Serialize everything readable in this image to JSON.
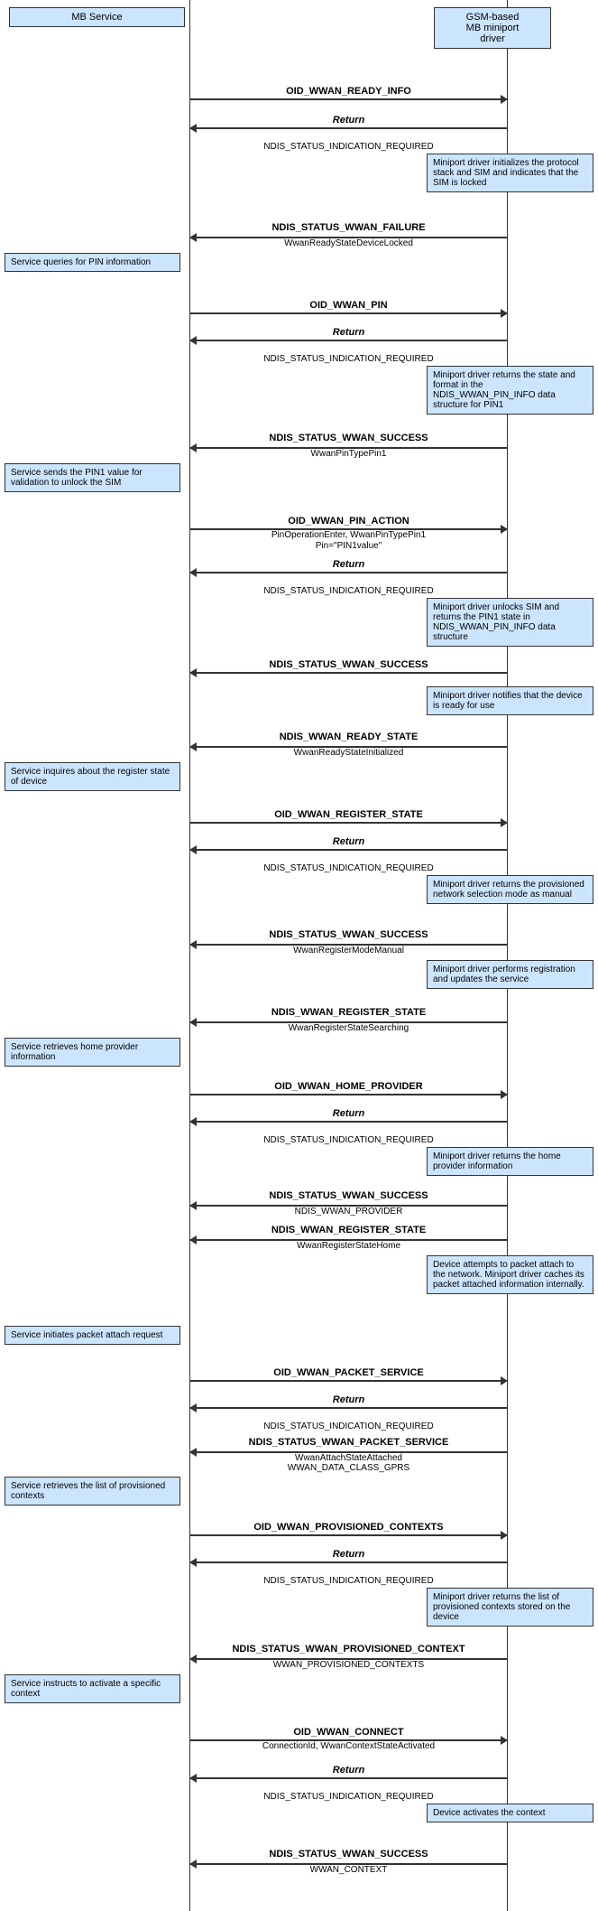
{
  "actors": {
    "left": "MB Service",
    "right": "GSM-based\nMB miniport\ndriver"
  },
  "sequence": [
    {
      "type": "arrow-right",
      "label": "OID_WWAN_READY_INFO",
      "sublabel": ""
    },
    {
      "type": "arrow-left",
      "label": "Return",
      "sublabel": ""
    },
    {
      "type": "text-center",
      "label": "NDIS_STATUS_INDICATION_REQUIRED"
    },
    {
      "type": "note-right",
      "text": "Miniport driver initializes the protocol stack and SIM and indicates that the SIM is locked"
    },
    {
      "type": "arrow-left",
      "label": "NDIS_STATUS_WWAN_FAILURE",
      "sublabel": "WwanReadyStateDeviceLocked"
    },
    {
      "type": "note-left",
      "text": "Service queries for PIN information"
    },
    {
      "type": "arrow-right",
      "label": "OID_WWAN_PIN",
      "sublabel": ""
    },
    {
      "type": "arrow-left",
      "label": "Return",
      "sublabel": ""
    },
    {
      "type": "text-center",
      "label": "NDIS_STATUS_INDICATION_REQUIRED"
    },
    {
      "type": "note-right",
      "text": "Miniport driver returns the state and format in the NDIS_WWAN_PIN_INFO data structure for PIN1"
    },
    {
      "type": "arrow-left",
      "label": "NDIS_STATUS_WWAN_SUCCESS",
      "sublabel": "WwanPinTypePin1"
    },
    {
      "type": "note-left",
      "text": "Service sends the PIN1 value for validation to unlock the SIM"
    },
    {
      "type": "arrow-right",
      "label": "OID_WWAN_PIN_ACTION",
      "sublabel": "PinOperationEnter, WwanPinTypePin1\nPin=\"PIN1value\""
    },
    {
      "type": "arrow-left",
      "label": "Return",
      "sublabel": ""
    },
    {
      "type": "text-center",
      "label": "NDIS_STATUS_INDICATION_REQUIRED"
    },
    {
      "type": "note-right",
      "text": "Miniport driver unlocks SIM and returns the PIN1 state in NDIS_WWAN_PIN_INFO data structure"
    },
    {
      "type": "arrow-left",
      "label": "NDIS_STATUS_WWAN_SUCCESS",
      "sublabel": ""
    },
    {
      "type": "note-right-inline",
      "text": "Miniport driver notifies that the device is ready for use"
    },
    {
      "type": "arrow-left",
      "label": "NDIS_WWAN_READY_STATE",
      "sublabel": "WwanReadyStateInitialized"
    },
    {
      "type": "note-left",
      "text": "Service inquires about the register state of device"
    },
    {
      "type": "arrow-right",
      "label": "OID_WWAN_REGISTER_STATE",
      "sublabel": ""
    },
    {
      "type": "arrow-left",
      "label": "Return",
      "sublabel": ""
    },
    {
      "type": "text-center",
      "label": "NDIS_STATUS_INDICATION_REQUIRED"
    },
    {
      "type": "note-right",
      "text": "Miniport driver returns the provisioned network selection mode as manual"
    },
    {
      "type": "arrow-left",
      "label": "NDIS_STATUS_WWAN_SUCCESS",
      "sublabel": "WwanRegisterModeManual"
    },
    {
      "type": "note-right-inline",
      "text": "Miniport driver performs registration and updates the service"
    },
    {
      "type": "arrow-left",
      "label": "NDIS_WWAN_REGISTER_STATE",
      "sublabel": "WwanRegisterStateSearching"
    },
    {
      "type": "note-left",
      "text": "Service retrieves home provider information"
    },
    {
      "type": "arrow-right",
      "label": "OID_WWAN_HOME_PROVIDER",
      "sublabel": ""
    },
    {
      "type": "arrow-left",
      "label": "Return",
      "sublabel": ""
    },
    {
      "type": "text-center",
      "label": "NDIS_STATUS_INDICATION_REQUIRED"
    },
    {
      "type": "note-right",
      "text": "Miniport driver returns the home provider information"
    },
    {
      "type": "arrow-left",
      "label": "NDIS_STATUS_WWAN_SUCCESS",
      "sublabel": "NDIS_WWAN_PROVIDER"
    },
    {
      "type": "arrow-left",
      "label": "NDIS_WWAN_REGISTER_STATE",
      "sublabel": "WwanRegisterStateHome"
    },
    {
      "type": "note-right",
      "text": "Device attempts to packet attach to the network. Miniport driver caches its packet attached information internally."
    },
    {
      "type": "note-left",
      "text": "Service initiates packet attach request"
    },
    {
      "type": "arrow-right",
      "label": "OID_WWAN_PACKET_SERVICE",
      "sublabel": ""
    },
    {
      "type": "arrow-left",
      "label": "Return",
      "sublabel": ""
    },
    {
      "type": "text-center",
      "label": "NDIS_STATUS_INDICATION_REQUIRED"
    },
    {
      "type": "arrow-left",
      "label": "NDIS_STATUS_WWAN_PACKET_SERVICE",
      "sublabel": "WwanAttachStateAttached\nWWAN_DATA_CLASS_GPRS"
    },
    {
      "type": "note-left",
      "text": "Service retrieves the list of provisioned contexts"
    },
    {
      "type": "arrow-right",
      "label": "OID_WWAN_PROVISIONED_CONTEXTS",
      "sublabel": ""
    },
    {
      "type": "arrow-left",
      "label": "Return",
      "sublabel": ""
    },
    {
      "type": "text-center",
      "label": "NDIS_STATUS_INDICATION_REQUIRED"
    },
    {
      "type": "note-right",
      "text": "Miniport driver returns the list of provisioned contexts stored on the device"
    },
    {
      "type": "arrow-left",
      "label": "NDIS_STATUS_WWAN_PROVISIONED_CONTEXT",
      "sublabel": "WWAN_PROVISIONED_CONTEXTS"
    },
    {
      "type": "note-left",
      "text": "Service instructs to activate a specific context"
    },
    {
      "type": "arrow-right",
      "label": "OID_WWAN_CONNECT",
      "sublabel": "ConnectionId, WwanContextStateActivated"
    },
    {
      "type": "arrow-left",
      "label": "Return",
      "sublabel": ""
    },
    {
      "type": "text-center",
      "label": "NDIS_STATUS_INDICATION_REQUIRED"
    },
    {
      "type": "note-right",
      "text": "Device activates the context"
    },
    {
      "type": "arrow-left",
      "label": "NDIS_STATUS_WWAN_SUCCESS",
      "sublabel": "WWAN_CONTEXT"
    }
  ]
}
